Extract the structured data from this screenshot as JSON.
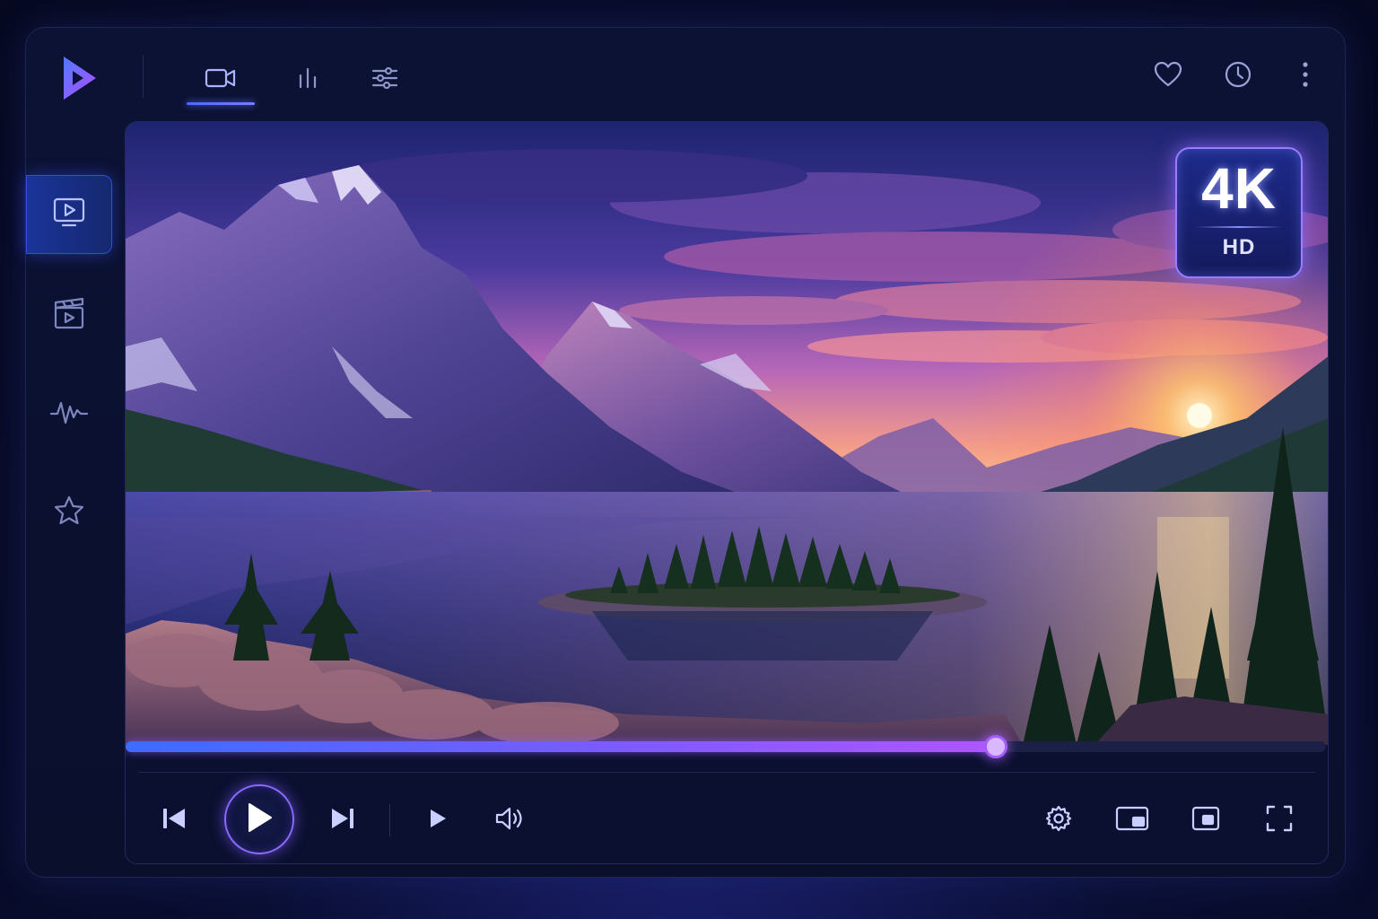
{
  "app": {
    "logo_icon": "play-triangle-logo",
    "accent": "#5b6cff",
    "accent_secondary": "#a35cff"
  },
  "top_tabs": [
    {
      "icon": "video-camera-icon",
      "active": true
    },
    {
      "icon": "bar-chart-icon",
      "active": false
    },
    {
      "icon": "sliders-icon",
      "active": false
    }
  ],
  "top_actions": [
    {
      "icon": "heart-icon"
    },
    {
      "icon": "clock-icon"
    },
    {
      "icon": "more-vertical-icon"
    }
  ],
  "sidebar": {
    "items": [
      {
        "icon": "monitor-play-icon",
        "active": true
      },
      {
        "icon": "clapperboard-icon",
        "active": false
      },
      {
        "icon": "waveform-icon",
        "active": false
      },
      {
        "icon": "star-icon",
        "active": false
      }
    ]
  },
  "video": {
    "badge": {
      "resolution": "4K",
      "quality": "HD"
    },
    "progress_fraction": 0.725
  },
  "controls": {
    "left": [
      {
        "icon": "skip-previous-icon"
      },
      {
        "icon": "play-icon"
      },
      {
        "icon": "skip-next-icon"
      },
      {
        "icon": "play-small-icon"
      },
      {
        "icon": "volume-icon"
      }
    ],
    "right": [
      {
        "icon": "settings-gear-icon"
      },
      {
        "icon": "picture-in-picture-icon"
      },
      {
        "icon": "mini-player-icon"
      },
      {
        "icon": "fullscreen-icon"
      }
    ]
  }
}
